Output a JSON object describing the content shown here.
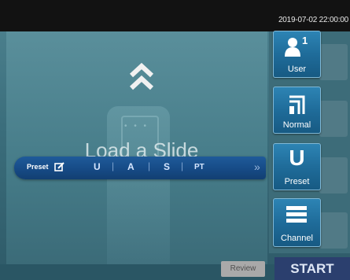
{
  "status_bar": {
    "datetime": "2019-07-02 22:00:00"
  },
  "main": {
    "load_label": "Load a Slide"
  },
  "preset_bar": {
    "label": "Preset",
    "options": [
      "U",
      "A",
      "S",
      "PT"
    ],
    "separator": "|",
    "more": "»"
  },
  "side_menu": {
    "user": {
      "label": "User",
      "badge": "1"
    },
    "mode": {
      "label": "Normal"
    },
    "preset": {
      "label": "Preset",
      "glyph": "U"
    },
    "channel": {
      "label": "Channel"
    }
  },
  "actions": {
    "review": "Review",
    "start": "START"
  },
  "colors": {
    "accent": "#1f6c9a",
    "preset_bar": "#174c88",
    "start": "#2b3f6e"
  }
}
